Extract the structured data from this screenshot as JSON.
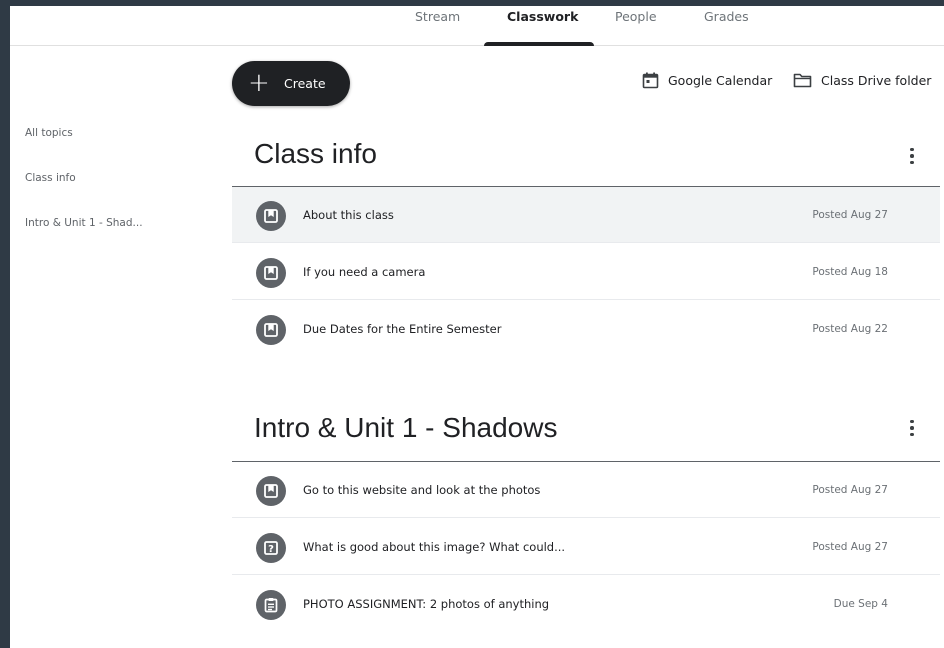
{
  "nav": {
    "tabs": [
      {
        "label": "Stream"
      },
      {
        "label": "Classwork"
      },
      {
        "label": "People"
      },
      {
        "label": "Grades"
      }
    ],
    "active_tab": "Classwork"
  },
  "sidebar": {
    "items": [
      {
        "label": "All topics"
      },
      {
        "label": "Class info"
      },
      {
        "label": "Intro & Unit 1 - Shad..."
      }
    ]
  },
  "toolbar": {
    "create_label": "Create",
    "calendar_label": "Google Calendar",
    "drive_label": "Class Drive folder"
  },
  "topics": [
    {
      "title": "Class info",
      "items": [
        {
          "title": "About this class",
          "meta": "Posted Aug 27",
          "icon": "material-icon"
        },
        {
          "title": "If you need a camera",
          "meta": "Posted Aug 18",
          "icon": "material-icon"
        },
        {
          "title": "Due Dates for the Entire Semester",
          "meta": "Posted Aug 22",
          "icon": "material-icon"
        }
      ]
    },
    {
      "title": "Intro & Unit 1 - Shadows",
      "items": [
        {
          "title": "Go to this website and look at the photos",
          "meta": "Posted Aug 27",
          "icon": "material-icon"
        },
        {
          "title": "What is good about this image? What could...",
          "meta": "Posted Aug 27",
          "icon": "question-icon"
        },
        {
          "title": "PHOTO ASSIGNMENT: 2 photos of anything",
          "meta": "Due Sep 4",
          "icon": "assignment-icon"
        }
      ]
    }
  ],
  "colors": {
    "frame": "#2f3a45",
    "icon_bg": "#5f6368",
    "create_bg": "#1f2124",
    "highlight": "#f1f3f4"
  }
}
